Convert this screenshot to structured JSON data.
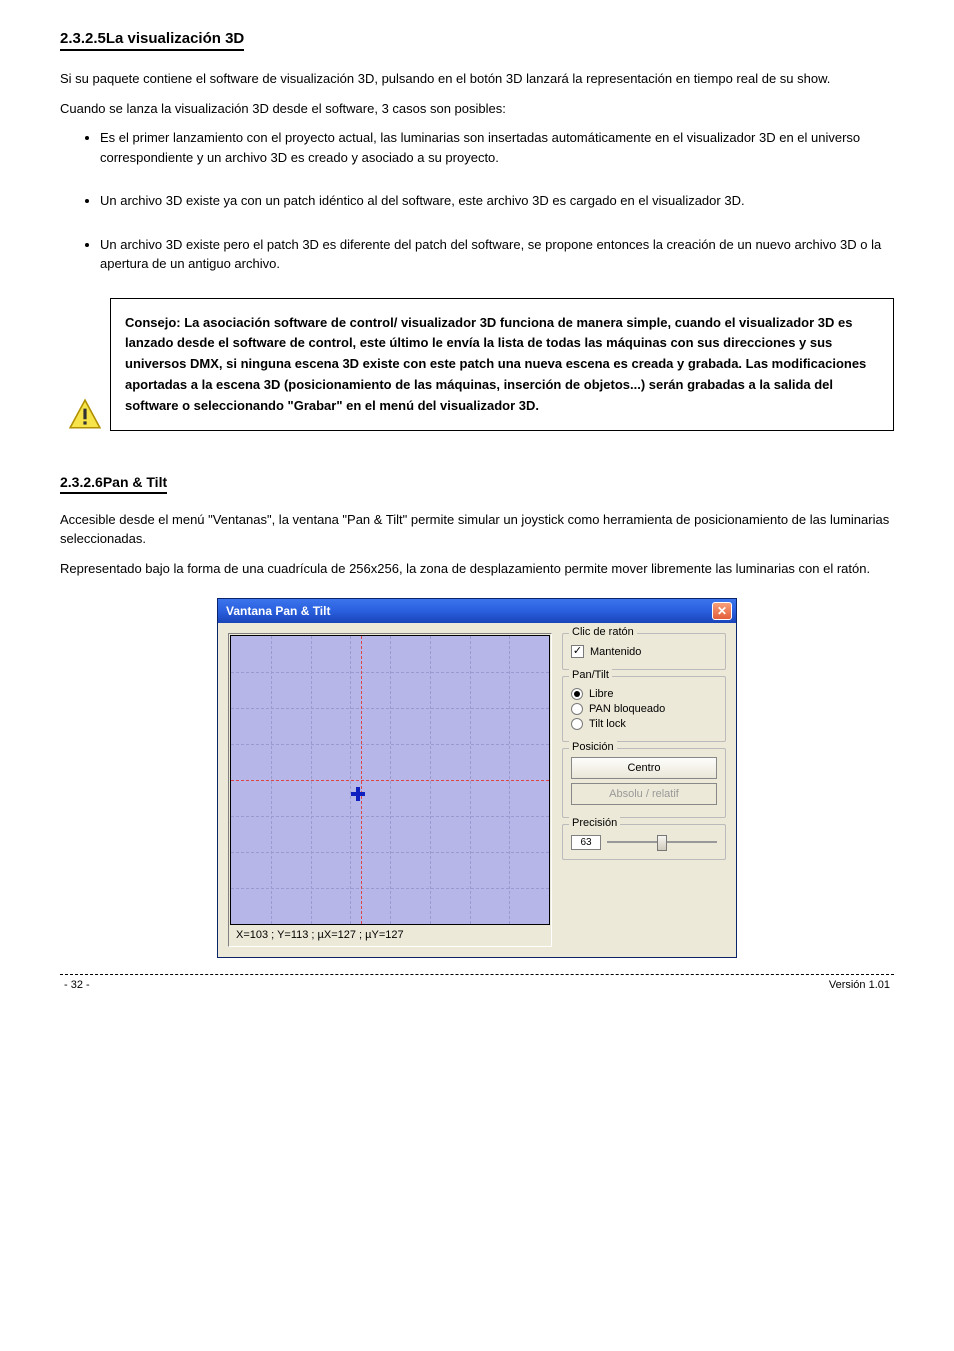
{
  "section1": {
    "title": "2.3.2.5La visualización 3D",
    "para1": "Si su paquete contiene el software de visualización 3D, pulsando en el botón 3D lanzará la representación en tiempo real de su show.",
    "para2": "Cuando se lanza la visualización 3D desde el software, 3 casos son posibles:",
    "bullets": [
      "Es el primer lanzamiento con el proyecto actual, las luminarias son insertadas automáticamente en el visualizador 3D en el universo correspondiente y un archivo 3D es creado y asociado a su proyecto.",
      "Un archivo 3D existe ya con un patch idéntico al del software, este archivo 3D es cargado en el visualizador 3D.",
      "Un archivo 3D existe pero el patch 3D es diferente del patch del software, se propone entonces la creación de un nuevo archivo 3D o la apertura de un antiguo archivo."
    ],
    "tip": "Consejo: La asociación software de control/ visualizador 3D funciona de manera simple, cuando el visualizador 3D es lanzado desde el software de control, este último le envía la lista de todas las máquinas con sus direcciones y sus universos DMX, si ninguna escena 3D existe con este patch una nueva escena es creada y grabada. Las modificaciones aportadas a la escena 3D (posicionamiento de las máquinas, inserción de objetos...) serán grabadas a la salida del software o seleccionando \"Grabar\" en el menú del visualizador 3D."
  },
  "section2": {
    "title": "2.3.2.6Pan & Tilt",
    "para1": "Accesible desde el menú \"Ventanas\", la ventana \"Pan & Tilt\" permite simular un joystick como herramienta de posicionamiento de las luminarias seleccionadas.",
    "para2": "Representado bajo la forma de una cuadrícula de 256x256, la zona de desplazamiento permite mover libremente las luminarias con el ratón."
  },
  "window": {
    "title": "Vantana Pan & Tilt",
    "coords": "X=103 ; Y=113 ; µX=127 ; µY=127",
    "group_click": {
      "legend": "Clic de ratón",
      "checkbox": "Mantenido",
      "checked": true
    },
    "group_pantilt": {
      "legend": "Pan/Tilt",
      "options": [
        {
          "label": "Libre",
          "selected": true
        },
        {
          "label": "PAN bloqueado",
          "selected": false
        },
        {
          "label": "Tilt lock",
          "selected": false
        }
      ]
    },
    "group_position": {
      "legend": "Posición",
      "btn_center": "Centro",
      "btn_absrel": "Absolu / relatif"
    },
    "group_precision": {
      "legend": "Precisión",
      "value": "63"
    }
  },
  "footer": {
    "left": "- 32 -",
    "right": "Versión 1.01"
  }
}
